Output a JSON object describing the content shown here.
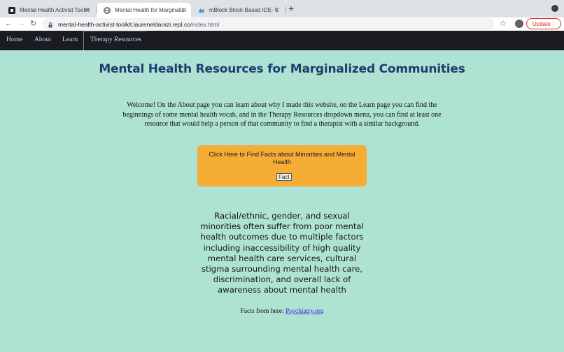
{
  "browser": {
    "tabs": [
      {
        "title": "Mental Health Activist Toolkit",
        "active": false,
        "icon": "replit-icon"
      },
      {
        "title": "Mental Health for Marginalized",
        "active": true,
        "icon": "globe-icon"
      },
      {
        "title": "mBlock Block-Based IDE- Cod",
        "active": false,
        "icon": "mblock-icon"
      }
    ],
    "close_glyph": "×",
    "new_tab_glyph": "+",
    "url_host": "mental-health-activist-toolkit.laureneldarazi.repl.co",
    "url_path": "/index.html",
    "update_label": "Update",
    "back_glyph": "←",
    "forward_glyph": "→",
    "reload_glyph": "↻",
    "star_glyph": "☆",
    "menu_glyph": "⋮"
  },
  "site_nav": {
    "items": [
      "Home",
      "About",
      "Learn",
      "Therapy Resources"
    ],
    "active": "Therapy Resources"
  },
  "main": {
    "title": "Mental Health Resources for Marginalized Communities",
    "welcome": "Welcome! On the About page you can learn about why I made this website, on the Learn page you can find the beginnings of some mental health vocab, and in the Therapy Resources dropdown menu, you can find at least one resource that would help a person of that community to find a therapist with a similar background.",
    "fact_box": {
      "prompt": "Click Here to Find Facts about Minorities and Mental Health",
      "button_label": "Fact"
    },
    "fact_text": "Racial/ethnic, gender, and sexual minorities often suffer from poor mental health outcomes due to multiple factors including inaccessibility of high quality mental health care services, cultural stigma surrounding mental health care, discrimination, and overall lack of awareness about mental health",
    "source_prefix": "Facts from here: ",
    "source_link": "Psychiatry.org"
  },
  "colors": {
    "page_bg": "#aee3d3",
    "nav_bg": "#1a1c22",
    "title": "#1f3c6e",
    "fact_box": "#f5ad36",
    "link": "#3a2bd1",
    "update": "#d93025"
  }
}
